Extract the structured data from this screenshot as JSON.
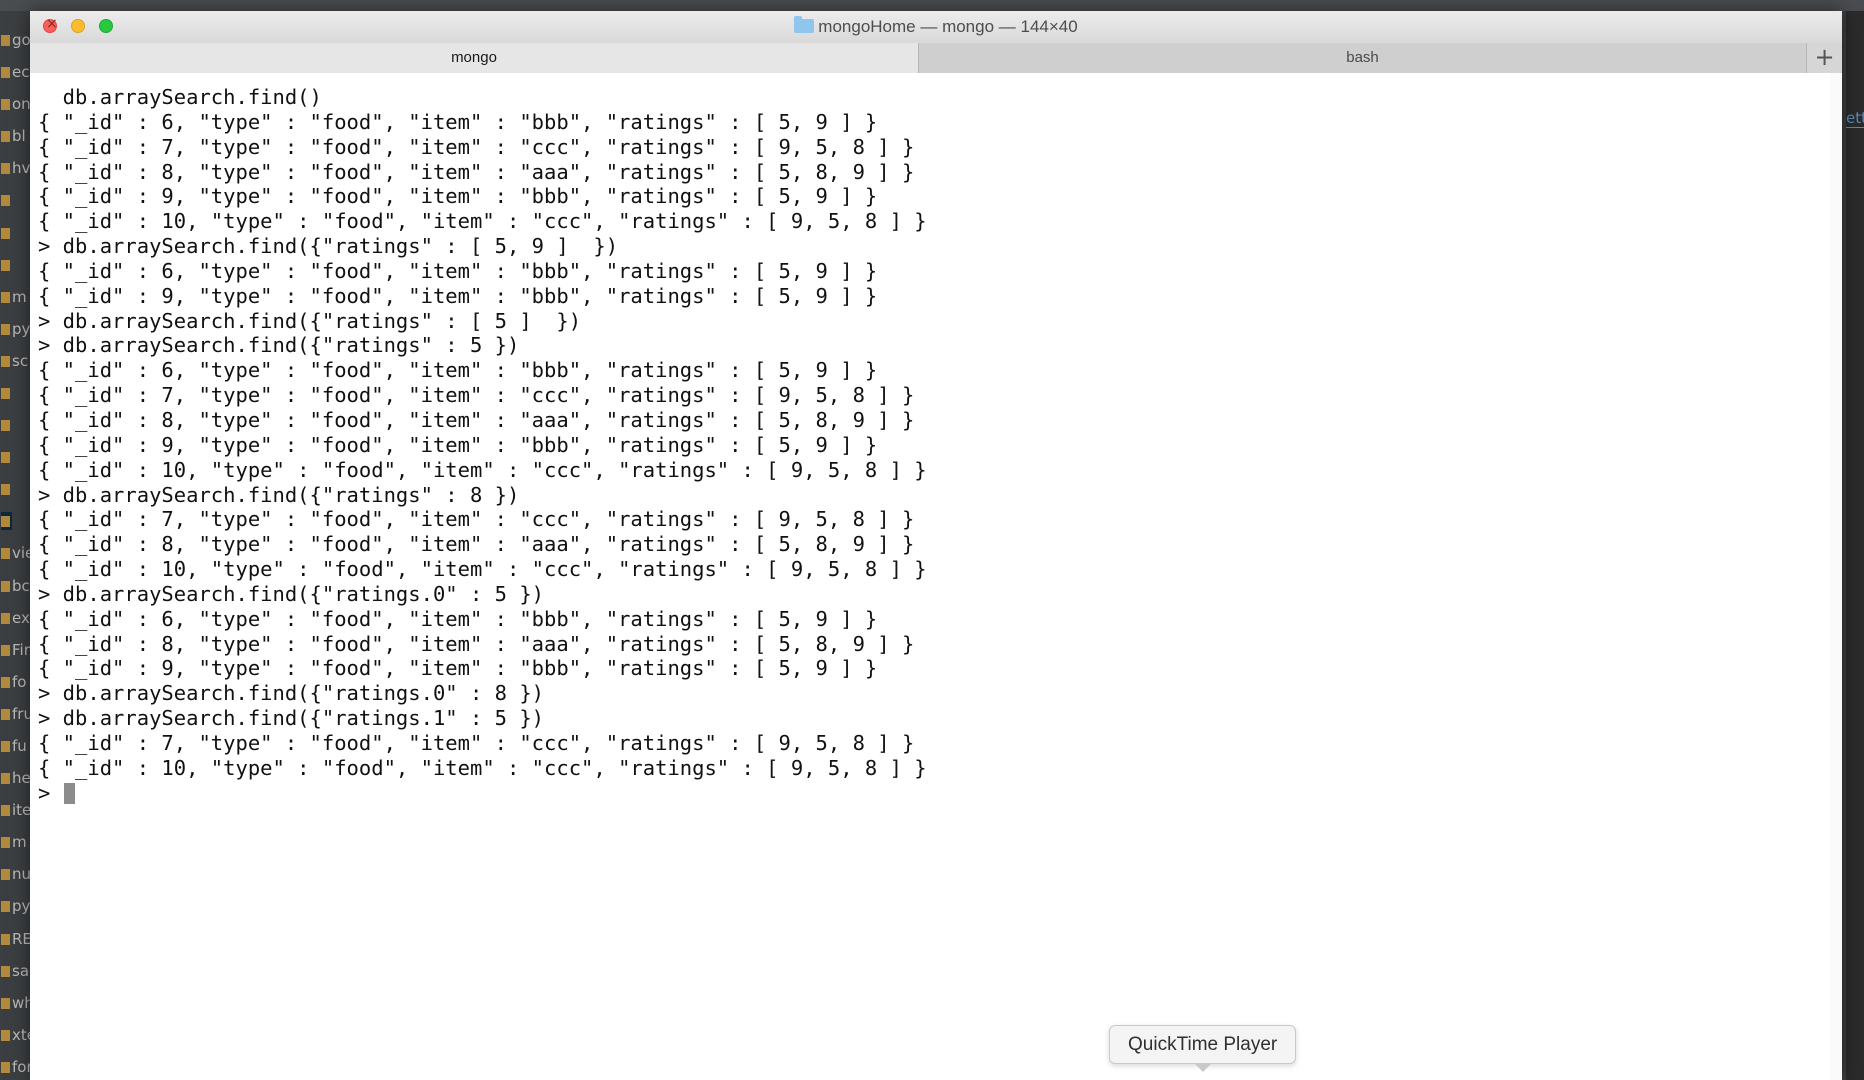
{
  "window": {
    "title": "mongoHome — mongo — 144×40",
    "folder_icon": "folder-icon",
    "traffic_lights": [
      "close-icon",
      "minimize-icon",
      "zoom-icon"
    ]
  },
  "tabs": [
    {
      "label": "mongo",
      "active": true
    },
    {
      "label": "bash",
      "active": false
    }
  ],
  "new_tab_label": "+",
  "terminal": {
    "lines": [
      "  db.arraySearch.find()",
      "{ \"_id\" : 6, \"type\" : \"food\", \"item\" : \"bbb\", \"ratings\" : [ 5, 9 ] }",
      "{ \"_id\" : 7, \"type\" : \"food\", \"item\" : \"ccc\", \"ratings\" : [ 9, 5, 8 ] }",
      "{ \"_id\" : 8, \"type\" : \"food\", \"item\" : \"aaa\", \"ratings\" : [ 5, 8, 9 ] }",
      "{ \"_id\" : 9, \"type\" : \"food\", \"item\" : \"bbb\", \"ratings\" : [ 5, 9 ] }",
      "{ \"_id\" : 10, \"type\" : \"food\", \"item\" : \"ccc\", \"ratings\" : [ 9, 5, 8 ] }",
      "> db.arraySearch.find({\"ratings\" : [ 5, 9 ]  })",
      "{ \"_id\" : 6, \"type\" : \"food\", \"item\" : \"bbb\", \"ratings\" : [ 5, 9 ] }",
      "{ \"_id\" : 9, \"type\" : \"food\", \"item\" : \"bbb\", \"ratings\" : [ 5, 9 ] }",
      "> db.arraySearch.find({\"ratings\" : [ 5 ]  })",
      "> db.arraySearch.find({\"ratings\" : 5 })",
      "{ \"_id\" : 6, \"type\" : \"food\", \"item\" : \"bbb\", \"ratings\" : [ 5, 9 ] }",
      "{ \"_id\" : 7, \"type\" : \"food\", \"item\" : \"ccc\", \"ratings\" : [ 9, 5, 8 ] }",
      "{ \"_id\" : 8, \"type\" : \"food\", \"item\" : \"aaa\", \"ratings\" : [ 5, 8, 9 ] }",
      "{ \"_id\" : 9, \"type\" : \"food\", \"item\" : \"bbb\", \"ratings\" : [ 5, 9 ] }",
      "{ \"_id\" : 10, \"type\" : \"food\", \"item\" : \"ccc\", \"ratings\" : [ 9, 5, 8 ] }",
      "> db.arraySearch.find({\"ratings\" : 8 })",
      "{ \"_id\" : 7, \"type\" : \"food\", \"item\" : \"ccc\", \"ratings\" : [ 9, 5, 8 ] }",
      "{ \"_id\" : 8, \"type\" : \"food\", \"item\" : \"aaa\", \"ratings\" : [ 5, 8, 9 ] }",
      "{ \"_id\" : 10, \"type\" : \"food\", \"item\" : \"ccc\", \"ratings\" : [ 9, 5, 8 ] }",
      "> db.arraySearch.find({\"ratings.0\" : 5 })",
      "{ \"_id\" : 6, \"type\" : \"food\", \"item\" : \"bbb\", \"ratings\" : [ 5, 9 ] }",
      "{ \"_id\" : 8, \"type\" : \"food\", \"item\" : \"aaa\", \"ratings\" : [ 5, 8, 9 ] }",
      "{ \"_id\" : 9, \"type\" : \"food\", \"item\" : \"bbb\", \"ratings\" : [ 5, 9 ] }",
      "> db.arraySearch.find({\"ratings.0\" : 8 })",
      "> db.arraySearch.find({\"ratings.1\" : 5 })",
      "{ \"_id\" : 7, \"type\" : \"food\", \"item\" : \"ccc\", \"ratings\" : [ 9, 5, 8 ] }",
      "{ \"_id\" : 10, \"type\" : \"food\", \"item\" : \"ccc\", \"ratings\" : [ 9, 5, 8 ] }"
    ],
    "prompt": "> "
  },
  "tooltip": {
    "label": "QuickTime Player"
  },
  "background_ide": {
    "sidebar_fragments": [
      "goC",
      "ect",
      "ong",
      "bl",
      "hv",
      "",
      "",
      "",
      "m",
      "py",
      "sc",
      "",
      "",
      "",
      "",
      "",
      "vie",
      "bc",
      "ex",
      "Fir",
      "fo",
      "fru",
      "fu",
      "he",
      "ite",
      "m",
      "nu",
      "py",
      "RE",
      "sa",
      "wh",
      "xter",
      "form"
    ],
    "right_fragment": "etti"
  }
}
